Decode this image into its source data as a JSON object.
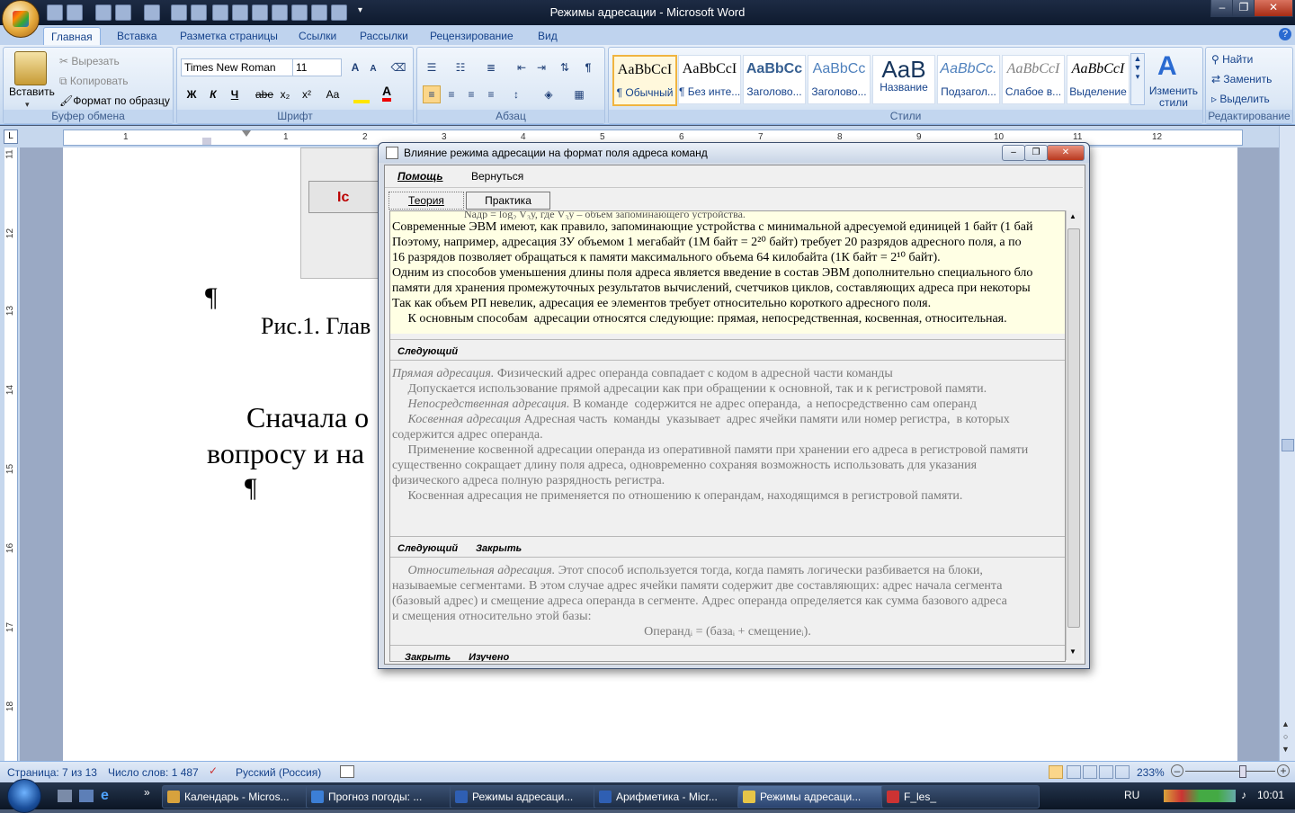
{
  "window": {
    "title": "Режимы адресации - Microsoft Word",
    "minimize": "–",
    "maximize": "❐",
    "close": "✕"
  },
  "ribbon_tabs": [
    "Главная",
    "Вставка",
    "Разметка страницы",
    "Ссылки",
    "Рассылки",
    "Рецензирование",
    "Вид"
  ],
  "clipboard": {
    "paste": "Вставить",
    "cut": "Вырезать",
    "copy": "Копировать",
    "format_painter": "Формат по образцу",
    "label": "Буфер обмена"
  },
  "font": {
    "name": "Times New Roman",
    "size": "11",
    "label": "Шрифт",
    "bold": "Ж",
    "italic": "К",
    "underline": "Ч",
    "strike": "abe",
    "sub": "x₂",
    "sup": "x²",
    "case": "Aa",
    "grow": "A",
    "shrink": "A"
  },
  "paragraph": {
    "label": "Абзац",
    "pilcrow": "¶"
  },
  "styles": {
    "label": "Стили",
    "items": [
      {
        "sample": "AaBbCcI",
        "name": "¶ Обычный"
      },
      {
        "sample": "AaBbCcI",
        "name": "¶ Без инте..."
      },
      {
        "sample": "AaBbCc",
        "name": "Заголово..."
      },
      {
        "sample": "AaBbCc",
        "name": "Заголово..."
      },
      {
        "sample": "AaB",
        "name": "Название"
      },
      {
        "sample": "AaBbCc.",
        "name": "Подзагол..."
      },
      {
        "sample": "AaBbCcI",
        "name": "Слабое в..."
      },
      {
        "sample": "AaBbCcI",
        "name": "Выделение"
      }
    ],
    "change": "Изменить стили"
  },
  "editing": {
    "label": "Редактирование",
    "find": "Найти",
    "replace": "Заменить",
    "select": "Выделить"
  },
  "ruler": {
    "marks": [
      "1",
      "1",
      "2",
      "3",
      "4",
      "5",
      "6",
      "7",
      "8",
      "9",
      "10",
      "11",
      "12"
    ],
    "vmarks": [
      "11",
      "12",
      "13",
      "14",
      "15",
      "16",
      "17",
      "18"
    ]
  },
  "document": {
    "pilcrow": "¶",
    "fig_caption": "Рис.1. Глав",
    "body1": "Сначала о",
    "body2": "вопросу и на",
    "btn_partial": "Ic"
  },
  "dialog": {
    "title": "Влияние режима адресации на формат поля адреса команд",
    "menu_help": "Помощь",
    "menu_back": "Вернуться",
    "tab_theory": "Теория",
    "tab_practice": "Практика",
    "top_partial": "Nадр = log₂ V₃у, где V₃у – объем запоминающего устройства.",
    "yellow": [
      "Современные ЭВМ имеют, как правило, запоминающие устройства с минимальной адресуемой единицей 1 байт (1 бай",
      "Поэтому, например, адресация ЗУ объемом 1 мегабайт (1М байт = 2²⁰ байт) требует 20 разрядов адресного поля, а по",
      "16 разрядов позволяет обращаться к памяти максимального объема 64 килобайта (1К байт = 2¹⁰ байт).",
      "Одним из способов уменьшения длины поля адреса является введение в состав ЭВМ дополнительно специального бло",
      "памяти  для хранения промежуточных результатов вычислений, счетчиков циклов, составляющих адреса при некоторы",
      "Так как объем РП невелик, адресация ее элементов требует относительно короткого адресного поля.",
      "     К основным способам  адресации относятся следующие: прямая, непосредственная, косвенная, относительная."
    ],
    "next": "Следующий",
    "close": "Закрыть",
    "learned": "Изучено",
    "g1_i": "Прямая адресация.",
    "g1": " Физический адрес операнда совпадает с кодом в адресной части команды",
    "g2": "     Допускается использование прямой адресации как при обращении к основной, так и к регистровой памяти.",
    "g3_i": "     Непосредственная адресация.",
    "g3": " В команде  содержится не адрес операнда,  а непосредственно сам операнд",
    "g4_i": "     Косвенная адресация",
    "g4": " Адресная часть  команды  указывает  адрес ячейки памяти или номер регистра,  в которых",
    "g5": "содержится адрес операнда.",
    "g6": "     Применение косвенной адресации операнда из оперативной памяти при хранении его адреса в регистровой памяти",
    "g7": "существенно сокращает длину поля адреса,  одновременно  сохраняя возможность использовать для указания",
    "g8": "физического адреса полную разрядность  регистра.",
    "g9": "     Косвенная адресация не применяется по отношению к операндам, находящимся в регистровой памяти.",
    "r1_i": "     Относительная адресация.",
    "r1": " Этот способ используется тогда, когда память логически разбивается на блоки,",
    "r2": "называемые сегментами. В этом случае адрес ячейки памяти содержит две составляющих: адрес начала сегмента",
    "r3": "(базовый адрес) и смещение адреса операнда в сегменте. Адрес операнда определяется как сумма базового  адреса",
    "r4": "и смещения относительно этой базы:",
    "formula": "Операндᵢ = (базаᵢ + смещениеᵢ)."
  },
  "status": {
    "page": "Страница: 7 из 13",
    "words": "Число слов: 1 487",
    "lang": "Русский (Россия)",
    "zoom": "233%"
  },
  "taskbar": {
    "items": [
      "Календарь - Micros...",
      "Прогноз погоды: ...",
      "Режимы адресаци...",
      "Арифметика - Micr...",
      "Режимы адресаци...",
      "F_les_"
    ],
    "lang": "RU",
    "time": "10:01"
  }
}
